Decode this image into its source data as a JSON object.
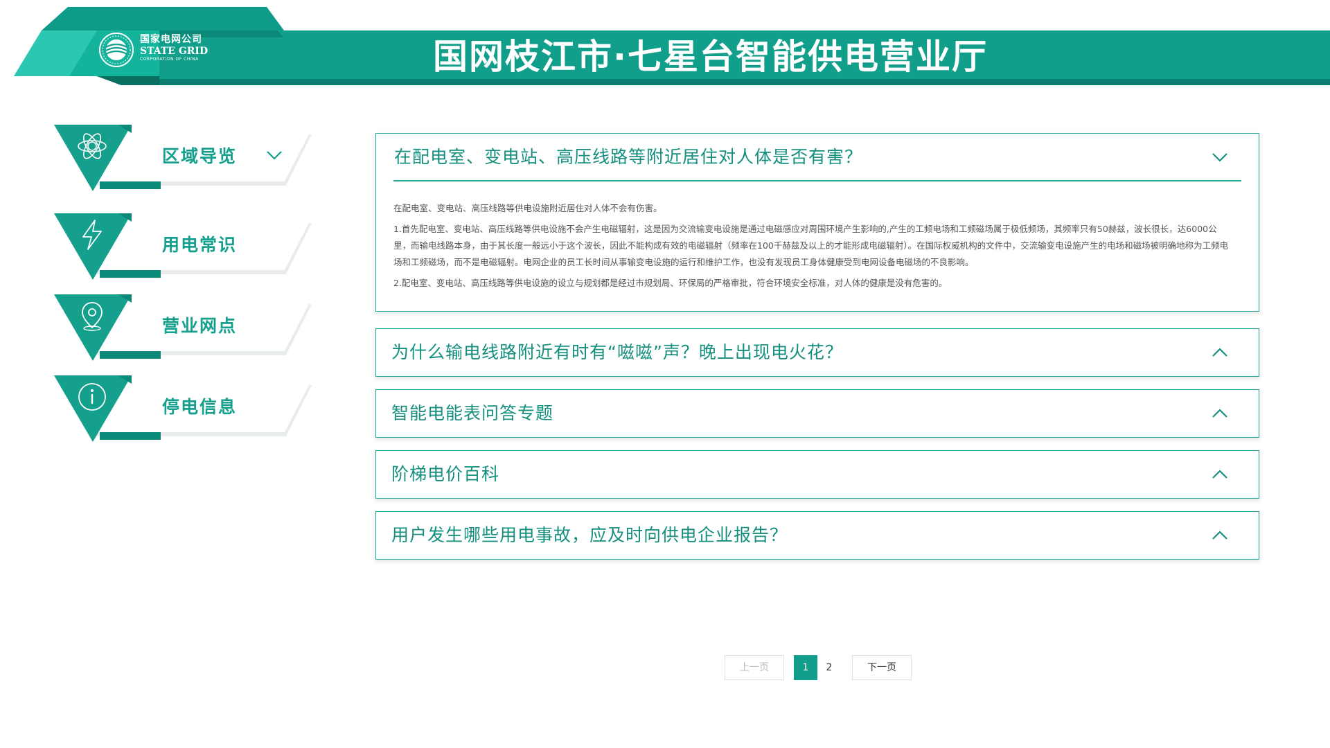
{
  "header": {
    "title": "国网枝江市·七星台智能供电营业厅",
    "logo": {
      "cn": "国家电网公司",
      "en": "STATE GRID",
      "en_sub": "CORPORATION OF CHINA",
      "icon": "state-grid-logo"
    }
  },
  "colors": {
    "brand": "#119e8a",
    "brand_dark": "#0a7e6e",
    "accent_light": "#21a592",
    "text_teal": "#148f7e"
  },
  "sidenav": {
    "items": [
      {
        "label": "区域导览",
        "icon": "atom-icon",
        "expanded": true
      },
      {
        "label": "用电常识",
        "icon": "lightning-icon",
        "active": true
      },
      {
        "label": "营业网点",
        "icon": "location-pin-icon"
      },
      {
        "label": "停电信息",
        "icon": "info-icon"
      }
    ]
  },
  "faq": {
    "items": [
      {
        "title": "在配电室、变电站、高压线路等附近居住对人体是否有害？",
        "expanded": true,
        "body": [
          "在配电室、变电站、高压线路等供电设施附近居住对人体不会有伤害。",
          "1.首先配电室、变电站、高压线路等供电设施不会产生电磁辐射，这是因为交流输变电设施是通过电磁感应对周围环境产生影响的,产生的工频电场和工频磁场属于极低频场，其频率只有50赫兹，波长很长，达6000公里，而输电线路本身，由于其长度一般远小于这个波长，因此不能构成有效的电磁辐射（频率在100千赫兹及以上的才能形成电磁辐射）。在国际权威机构的文件中，交流输变电设施产生的电场和磁场被明确地称为工频电场和工频磁场，而不是电磁辐射。电网企业的员工长时间从事输变电设施的运行和维护工作，也没有发现员工身体健康受到电网设备电磁场的不良影响。",
          "2.配电室、变电站、高压线路等供电设施的设立与规划都是经过市规划局、环保局的严格审批，符合环境安全标准，对人体的健康是没有危害的。"
        ]
      },
      {
        "title": "为什么输电线路附近有时有“嗞嗞”声？晚上出现电火花？",
        "expanded": false
      },
      {
        "title": "智能电能表问答专题",
        "expanded": false
      },
      {
        "title": "阶梯电价百科",
        "expanded": false
      },
      {
        "title": "用户发生哪些用电事故，应及时向供电企业报告？",
        "expanded": false
      }
    ]
  },
  "pagination": {
    "prev": "上一页",
    "pages": [
      "1",
      "2"
    ],
    "current": "1",
    "next": "下一页"
  }
}
